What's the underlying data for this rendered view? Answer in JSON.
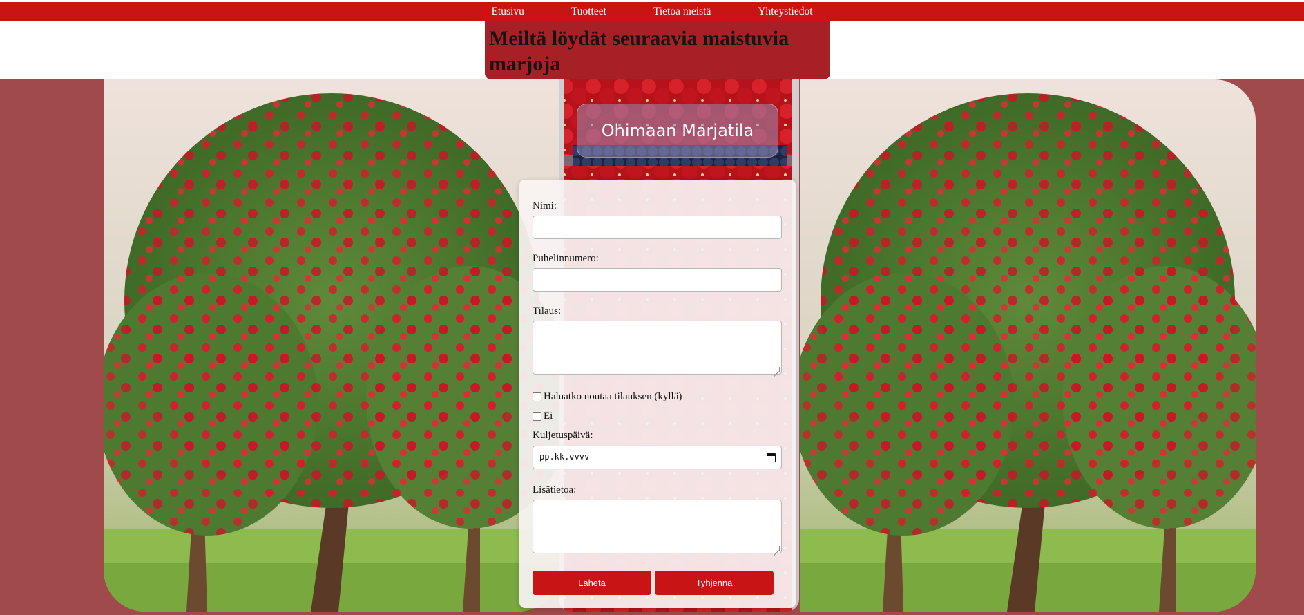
{
  "nav": {
    "items": [
      "Etusivu",
      "Tuotteet",
      "Tietoa meistä",
      "Yhteystiedot"
    ]
  },
  "header": {
    "heading": "Meiltä löydät seuraavia maistuvia marjoja"
  },
  "hero": {
    "farm_name": "Ohimaan Marjatila"
  },
  "form": {
    "name_label": "Nimi:",
    "phone_label": "Puhelinnumero:",
    "order_label": "Tilaus:",
    "pickup_yes_label": "Haluatko noutaa tilauksen (kyllä)",
    "pickup_no_label": "Ei",
    "delivery_date_label": "Kuljetuspäivä:",
    "delivery_date_placeholder": "pp.kk.vvvv",
    "extra_label": "Lisätietoa:",
    "submit_label": "Lähetä",
    "reset_label": "Tyhjennä"
  },
  "colors": {
    "brand_red": "#c81414",
    "heading_bg": "#a62025",
    "band_bg": "#a14a4c"
  },
  "icons": {
    "calendar": "calendar-icon"
  }
}
